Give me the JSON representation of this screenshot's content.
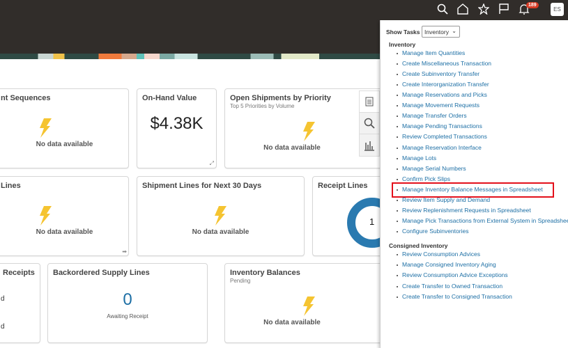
{
  "header": {
    "notification_count": "189",
    "avatar_initials": "ES"
  },
  "cards": {
    "seq": {
      "title": "nt Sequences",
      "empty": "No data available"
    },
    "onhand": {
      "title": "On-Hand Value",
      "value": "$4.38K"
    },
    "openship": {
      "title": "Open Shipments by Priority",
      "subtitle": "Top 5 Priorities by Volume",
      "empty": "No data available"
    },
    "lines": {
      "title": "Lines",
      "empty": "No data available"
    },
    "ship30": {
      "title": "Shipment Lines for Next 30 Days",
      "empty": "No data available"
    },
    "receipt": {
      "title": "Receipt Lines",
      "value": "1"
    },
    "receipts": {
      "title": "Receipts",
      "row1": "d",
      "row2": "d"
    },
    "backorder": {
      "title": "Backordered Supply Lines",
      "value": "0",
      "caption": "Awaiting Receipt"
    },
    "invbal": {
      "title": "Inventory Balances",
      "subtitle": "Pending",
      "empty": "No data available"
    }
  },
  "tasks": {
    "show_label": "Show Tasks",
    "selected": "Inventory",
    "groups": [
      {
        "name": "Inventory",
        "items": [
          "Manage Item Quantities",
          "Create Miscellaneous Transaction",
          "Create Subinventory Transfer",
          "Create Interorganization Transfer",
          "Manage Reservations and Picks",
          "Manage Movement Requests",
          "Manage Transfer Orders",
          "Manage Pending Transactions",
          "Review Completed Transactions",
          "Manage Reservation Interface",
          "Manage Lots",
          "Manage Serial Numbers",
          "Confirm Pick Slips",
          "Manage Inventory Balance Messages in Spreadsheet",
          "Review Item Supply and Demand",
          "Review Replenishment Requests in Spreadsheet",
          "Manage Pick Transactions from External System in Spreadsheet",
          "Configure Subinventories"
        ]
      },
      {
        "name": "Consigned Inventory",
        "items": [
          "Review Consumption Advices",
          "Manage Consigned Inventory Aging",
          "Review Consumption Advice Exceptions",
          "Create Transfer to Owned Transaction",
          "Create Transfer to Consigned Transaction"
        ]
      }
    ]
  },
  "colors": {
    "header": "#312d2a",
    "link": "#1d6fa5",
    "highlight": "#e3101b",
    "bolt": "#f5c431",
    "donut": "#2a7ab0"
  }
}
